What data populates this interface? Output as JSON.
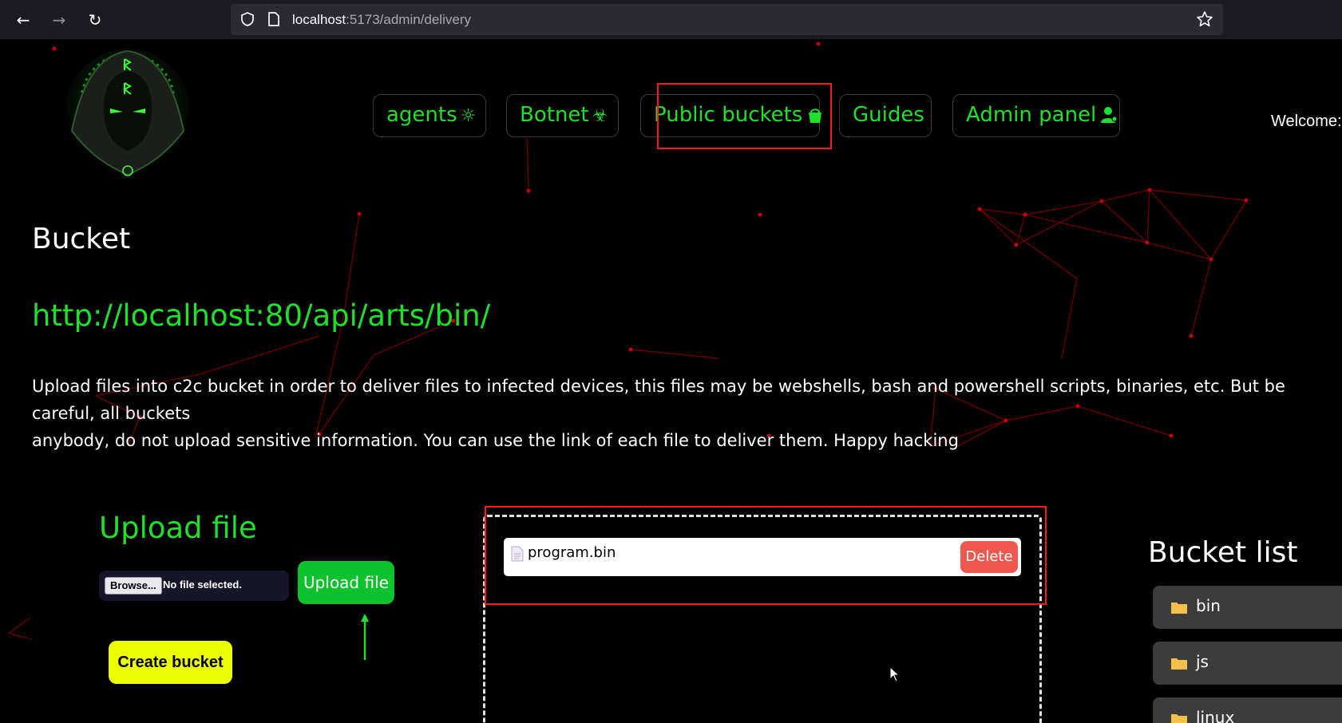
{
  "browser": {
    "url_host": "localhost",
    "url_rest": ":5173/admin/delivery"
  },
  "nav": {
    "agents": "agents",
    "botnet": "Botnet",
    "public_buckets": "Public buckets",
    "guides": "Guides",
    "admin_panel": "Admin panel"
  },
  "welcome": "Welcome:",
  "bucket": {
    "title": "Bucket",
    "url": "http://localhost:80/api/arts/bin/",
    "description": "Upload files into c2c bucket in order to deliver files to infected devices, this files may be webshells, bash and powershell scripts, binaries, etc. But be careful, all buckets\nanybody, do not upload sensitive information. You can use the link of each file to deliver them. Happy hacking"
  },
  "upload": {
    "title": "Upload file",
    "browse_label": "Browse...",
    "no_file_label": "No file selected.",
    "upload_button": "Upload file",
    "create_bucket_button": "Create bucket"
  },
  "files": [
    {
      "name": "program.bin",
      "delete_label": "Delete"
    }
  ],
  "bucket_list": {
    "title": "Bucket list",
    "items": [
      "bin",
      "js",
      "linux"
    ]
  },
  "colors": {
    "accent_green": "#1fe02b",
    "create_yellow": "#ecff00",
    "delete_red": "#f0584f",
    "highlight_red": "#ff1a1a"
  }
}
